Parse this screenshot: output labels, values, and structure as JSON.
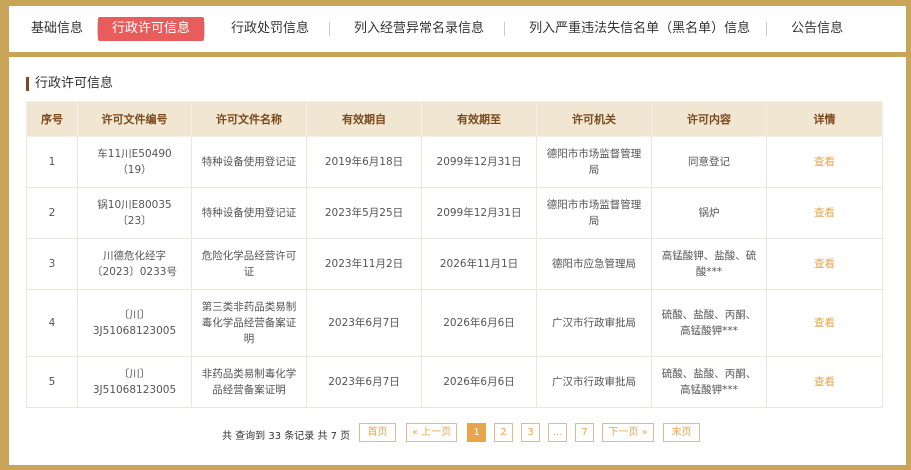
{
  "tabs": [
    {
      "label": "基础信息"
    },
    {
      "label": "行政许可信息"
    },
    {
      "label": "行政处罚信息"
    },
    {
      "label": "列入经营异常名录信息"
    },
    {
      "label": "列入严重违法失信名单（黑名单）信息"
    },
    {
      "label": "公告信息"
    }
  ],
  "section_title": "行政许可信息",
  "table": {
    "headers": [
      "序号",
      "许可文件编号",
      "许可文件名称",
      "有效期自",
      "有效期至",
      "许可机关",
      "许可内容",
      "详情"
    ],
    "rows": [
      [
        "1",
        "车11川E50490（19）",
        "特种设备使用登记证",
        "2019年6月18日",
        "2099年12月31日",
        "德阳市市场监督管理局",
        "同意登记",
        "查看"
      ],
      [
        "2",
        "锅10川E80035〔23〕",
        "特种设备使用登记证",
        "2023年5月25日",
        "2099年12月31日",
        "德阳市市场监督管理局",
        "锅炉",
        "查看"
      ],
      [
        "3",
        "川德危化经字〔2023〕0233号",
        "危险化学品经营许可证",
        "2023年11月2日",
        "2026年11月1日",
        "德阳市应急管理局",
        "高锰酸钾、盐酸、硫酸***",
        "查看"
      ],
      [
        "4",
        "〔川〕3J51068123005",
        "第三类非药品类易制毒化学品经营备案证明",
        "2023年6月7日",
        "2026年6月6日",
        "广汉市行政审批局",
        "硫酸、盐酸、丙酮、高锰酸钾***",
        "查看"
      ],
      [
        "5",
        "〔川〕3J51068123005",
        "非药品类易制毒化学品经营备案证明",
        "2023年6月7日",
        "2026年6月6日",
        "广汉市行政审批局",
        "硫酸、盐酸、丙酮、高锰酸钾***",
        "查看"
      ]
    ]
  },
  "pagination": {
    "info": "共 查询到 33 条记录 共 7 页",
    "first": "首页",
    "prev": "« 上一页",
    "pages": [
      "1",
      "2",
      "3",
      "...",
      "7"
    ],
    "current": "1",
    "next": "下一页 »",
    "last": "末页"
  },
  "colors": {
    "frame": "#c9a55a",
    "active_tab": "#e85c5c",
    "header_bg": "#f0e6d2",
    "link": "#e8a54b"
  }
}
